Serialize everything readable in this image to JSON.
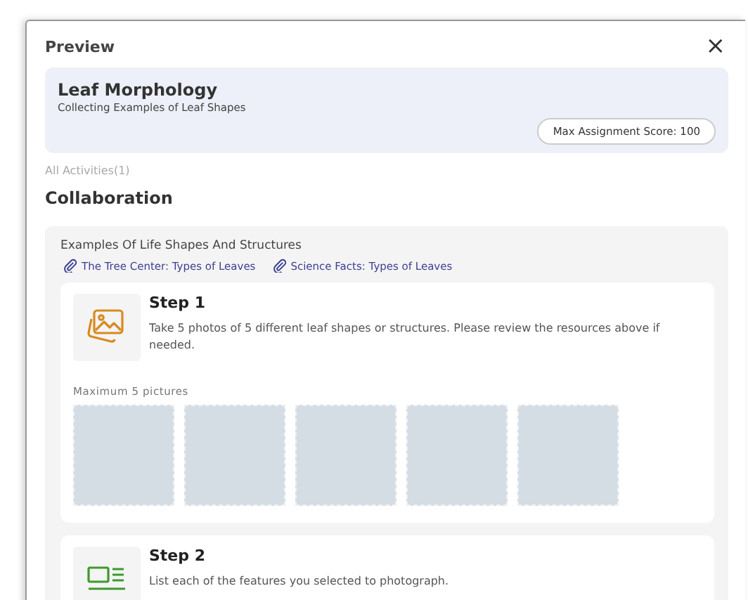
{
  "dialog": {
    "title": "Preview",
    "close": "×"
  },
  "assignment": {
    "title": "Leaf Morphology",
    "subtitle": "Collecting Examples of Leaf Shapes",
    "score": "Max Assignment Score: 100"
  },
  "activities_label": "All Activities(1)",
  "section_title": "Collaboration",
  "activity": {
    "title": "Examples Of Life Shapes And Structures",
    "links": [
      "The Tree Center: Types of Leaves",
      "Science Facts: Types of Leaves"
    ],
    "steps": [
      {
        "kind": "photo",
        "title": "Step 1",
        "text": "Take 5 photos of 5 different leaf shapes or structures. Please review the resources above if needed.",
        "upload_label": "Maximum 5 pictures",
        "slots": [
          {
            "filled": false
          },
          {
            "filled": false
          },
          {
            "filled": false
          },
          {
            "filled": false
          },
          {
            "filled": false
          }
        ]
      },
      {
        "kind": "list",
        "title": "Step 2",
        "text": "List each of the features you selected to photograph."
      }
    ]
  }
}
